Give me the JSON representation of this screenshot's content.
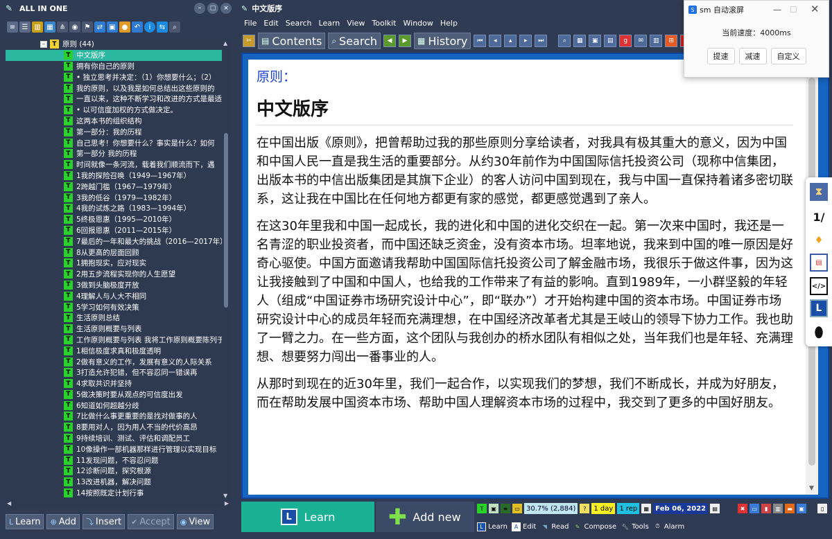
{
  "left_window": {
    "title": "ALL IN ONE",
    "tree": {
      "root": {
        "label": "原则 (44)"
      },
      "items": [
        "中文版序",
        "拥有你自己的原则",
        "• 独立思考并决定：（1）你想要什么；（2）",
        "我的原则，以及我是如何总结出这些原则的",
        "一直以来，这种不断学习和改进的方式是最适",
        "• 以可信度加权的方式做决定。",
        "这两本书的组织结构",
        "第一部分：我的历程",
        "自己思考！你想要什么？事实是什么？如何",
        "第一部分 我的历程",
        "时间就像一条河流，载着我们顺流而下，遇",
        "1我的探险召唤（1949—1967年）",
        "2跨越门槛（1967—1979年）",
        "3我的低谷（1979—1982年）",
        "4我的试炼之路（1983—1994年）",
        "5终极恩惠（1995—2010年）",
        "6回报恩惠（2011—2015年）",
        "7最后的一年和最大的挑战（2016—2017年）",
        "8从更高的层面回顾",
        "1拥抱现实，应对现实",
        "2用五步流程实现你的人生愿望",
        "3做到头脑极度开放",
        "4理解人与人大不相同",
        "5学习如何有效决策",
        "生活原则总结",
        "生活原则概要与列表",
        "工作原则概要与列表 我将工作原则概要陈列于",
        "1相信极度求真和极度透明",
        "2做有意义的工作，发展有意义的人际关系",
        "3打造允许犯错，但不容忍同一错误再",
        "4求取共识并坚持",
        "5做决策时要从观点的可信度出发",
        "6知道如何超越分歧",
        "7比做什么事更重要的是找对做事的人",
        "8要用对人，因为用人不当的代价高昂",
        "9持续培训、测试、评估和调配员工",
        "10像操作一部机器那样进行管理以实现目标",
        "11发现问题，不容忍问题",
        "12诊断问题，探究根源",
        "13改进机器，解决问题",
        "14按照既定计划行事"
      ]
    },
    "bottom_buttons": {
      "learn": "Learn",
      "add": "Add",
      "insert": "Insert",
      "accept": "Accept",
      "view": "View"
    }
  },
  "right_window": {
    "title": "中文版序",
    "menu": [
      "File",
      "Edit",
      "Search",
      "Learn",
      "View",
      "Toolkit",
      "Window",
      "Help"
    ],
    "toolbar": {
      "contents": "Contents",
      "search": "Search",
      "history": "History"
    },
    "document": {
      "heading_small": "原则：",
      "heading_large": "中文版序",
      "paragraphs": [
        "在中国出版《原则》，把曾帮助过我的那些原则分享给读者，对我具有极其重大的意义，因为中国和中国人民一直是我生活的重要部分。从约30年前作为中国国际信托投资公司（现称中信集团，出版本书的中信出版集团是其旗下企业）的客人访问中国到现在，我与中国一直保持着诸多密切联系，这让我在中国比在任何地方都更有家的感觉，都更感觉遇到了亲人。",
        "在这30年里我和中国一起成长，我的进化和中国的进化交织在一起。第一次来中国时，我还是一名青涩的职业投资者，而中国还缺乏资金，没有资本市场。坦率地说，我来到中国的唯一原因是好奇心驱使。中国方面邀请我帮助中国国际信托投资公司了解金融市场，我很乐于做这件事，因为这让我接触到了中国和中国人，也给我的工作带来了有益的影响。直到1989年，一小群坚毅的年轻人（组成“中国证券市场研究设计中心”，即“联办”）才开始构建中国的资本市场。中国证券市场研究设计中心的成员年轻而充满理想，在中国经济改革者尤其是王岐山的领导下协力工作。我也助了一臂之力。在一些方面，这个团队与我创办的桥水团队有相似之处，当年我们也是年轻、充满理想、想要努力闯出一番事业的人。",
        "从那时到现在的近30年里，我们一起合作，以实现我们的梦想，我们不断成长，并成为好朋友，而在帮助发展中国资本市场、帮助中国人理解资本市场的过程中，我交到了更多的中国好朋友。"
      ]
    },
    "bottom": {
      "learn_button": "Learn",
      "add_new_button": "Add new",
      "status_percent": "30.7% (2,884)",
      "status_day": "1 day",
      "status_rep": "1 rep",
      "status_date": "Feb 06, 2022",
      "tabs": [
        "Learn",
        "Edit",
        "Read",
        "Compose",
        "Tools",
        "Alarm"
      ]
    }
  },
  "popup": {
    "title": "sm 自动滚屏",
    "logo_letter": "S",
    "speed_text": "当前速度：4000ms",
    "buttons": [
      "提速",
      "减速",
      "自定义"
    ]
  },
  "colors": {
    "selection": "#2bb8a0",
    "tree_icon": "#2bd12b",
    "doc_heading": "#1a3fd4",
    "doc_frame": "#1565c0"
  }
}
